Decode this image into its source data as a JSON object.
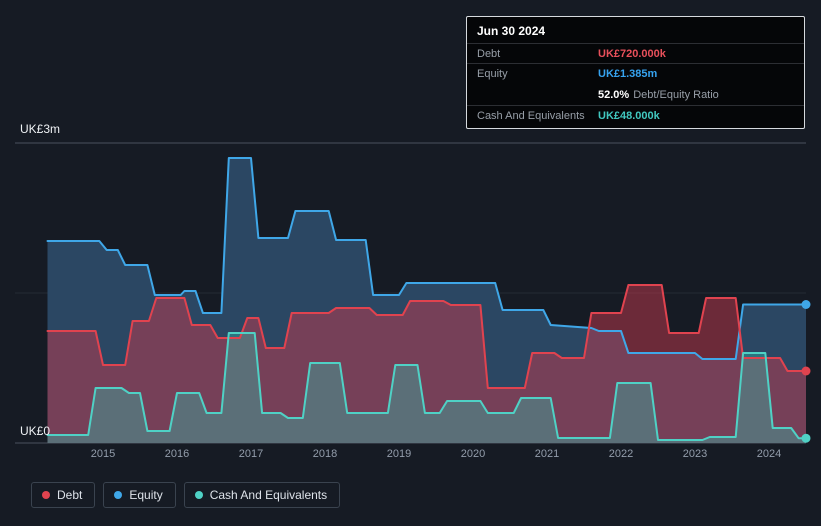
{
  "tooltip": {
    "date": "Jun 30 2024",
    "rows": {
      "debt_label": "Debt",
      "debt_value": "UK£720.000k",
      "equity_label": "Equity",
      "equity_value": "UK£1.385m",
      "ratio_value": "52.0%",
      "ratio_label": "Debt/Equity Ratio",
      "cash_label": "Cash And Equivalents",
      "cash_value": "UK£48.000k"
    }
  },
  "axis": {
    "y_top": "UK£3m",
    "y_bottom": "UK£0",
    "years": [
      "2015",
      "2016",
      "2017",
      "2018",
      "2019",
      "2020",
      "2021",
      "2022",
      "2023",
      "2024"
    ]
  },
  "legend": [
    {
      "label": "Debt",
      "color": "#e0434f"
    },
    {
      "label": "Equity",
      "color": "#3fa7e8"
    },
    {
      "label": "Cash And Equivalents",
      "color": "#4fd1c5"
    }
  ],
  "colors": {
    "debt": "#e8505b",
    "equity": "#36a3f0",
    "cash": "#41c8c0"
  },
  "chart_data": {
    "type": "area",
    "title": "",
    "y_unit": "UK£m",
    "ylim": [
      0,
      3
    ],
    "x_range": [
      2014.2,
      2024.55
    ],
    "x_ticks": [
      2015,
      2016,
      2017,
      2018,
      2019,
      2020,
      2021,
      2022,
      2023,
      2024
    ],
    "grid": "horizontal",
    "legend_position": "bottom-left",
    "last_point": {
      "date": "Jun 30 2024",
      "debt_m": 0.72,
      "equity_m": 1.385,
      "cash_m": 0.048,
      "debt_equity_ratio_pct": 52.0
    },
    "series": [
      {
        "name": "Equity",
        "color": "#3fa7e8",
        "fill": "#2b4763",
        "fill_opacity": 1,
        "points": [
          [
            2014.25,
            2.02
          ],
          [
            2014.95,
            2.02
          ],
          [
            2015.05,
            1.93
          ],
          [
            2015.2,
            1.93
          ],
          [
            2015.3,
            1.78
          ],
          [
            2015.6,
            1.78
          ],
          [
            2015.7,
            1.48
          ],
          [
            2016.05,
            1.48
          ],
          [
            2016.1,
            1.52
          ],
          [
            2016.25,
            1.52
          ],
          [
            2016.35,
            1.3
          ],
          [
            2016.6,
            1.3
          ],
          [
            2016.7,
            2.85
          ],
          [
            2017.0,
            2.85
          ],
          [
            2017.1,
            2.05
          ],
          [
            2017.5,
            2.05
          ],
          [
            2017.6,
            2.32
          ],
          [
            2018.05,
            2.32
          ],
          [
            2018.15,
            2.03
          ],
          [
            2018.55,
            2.03
          ],
          [
            2018.65,
            1.48
          ],
          [
            2019.0,
            1.48
          ],
          [
            2019.1,
            1.6
          ],
          [
            2020.3,
            1.6
          ],
          [
            2020.4,
            1.33
          ],
          [
            2020.95,
            1.33
          ],
          [
            2021.05,
            1.18
          ],
          [
            2021.6,
            1.15
          ],
          [
            2021.7,
            1.12
          ],
          [
            2022.0,
            1.12
          ],
          [
            2022.1,
            0.9
          ],
          [
            2023.0,
            0.9
          ],
          [
            2023.1,
            0.84
          ],
          [
            2023.55,
            0.84
          ],
          [
            2023.65,
            1.385
          ],
          [
            2024.5,
            1.385
          ]
        ]
      },
      {
        "name": "Debt",
        "color": "#e0434f",
        "fill": "#c23a4e",
        "fill_opacity": 0.5,
        "points": [
          [
            2014.25,
            1.12
          ],
          [
            2014.9,
            1.12
          ],
          [
            2015.0,
            0.78
          ],
          [
            2015.3,
            0.78
          ],
          [
            2015.4,
            1.22
          ],
          [
            2015.62,
            1.22
          ],
          [
            2015.72,
            1.45
          ],
          [
            2016.1,
            1.45
          ],
          [
            2016.2,
            1.18
          ],
          [
            2016.45,
            1.18
          ],
          [
            2016.55,
            1.05
          ],
          [
            2016.85,
            1.05
          ],
          [
            2016.95,
            1.25
          ],
          [
            2017.1,
            1.25
          ],
          [
            2017.2,
            0.95
          ],
          [
            2017.45,
            0.95
          ],
          [
            2017.55,
            1.3
          ],
          [
            2018.05,
            1.3
          ],
          [
            2018.15,
            1.35
          ],
          [
            2018.6,
            1.35
          ],
          [
            2018.7,
            1.28
          ],
          [
            2019.05,
            1.28
          ],
          [
            2019.15,
            1.42
          ],
          [
            2019.6,
            1.42
          ],
          [
            2019.7,
            1.38
          ],
          [
            2020.1,
            1.38
          ],
          [
            2020.2,
            0.55
          ],
          [
            2020.7,
            0.55
          ],
          [
            2020.8,
            0.9
          ],
          [
            2021.1,
            0.9
          ],
          [
            2021.2,
            0.85
          ],
          [
            2021.5,
            0.85
          ],
          [
            2021.6,
            1.3
          ],
          [
            2022.0,
            1.3
          ],
          [
            2022.1,
            1.58
          ],
          [
            2022.55,
            1.58
          ],
          [
            2022.65,
            1.1
          ],
          [
            2023.05,
            1.1
          ],
          [
            2023.15,
            1.45
          ],
          [
            2023.55,
            1.45
          ],
          [
            2023.65,
            0.85
          ],
          [
            2024.15,
            0.85
          ],
          [
            2024.25,
            0.72
          ],
          [
            2024.5,
            0.72
          ]
        ]
      },
      {
        "name": "Cash And Equivalents",
        "color": "#4fd1c5",
        "fill": "#2fbcae",
        "fill_opacity": 0.38,
        "points": [
          [
            2014.25,
            0.08
          ],
          [
            2014.8,
            0.08
          ],
          [
            2014.9,
            0.55
          ],
          [
            2015.25,
            0.55
          ],
          [
            2015.35,
            0.5
          ],
          [
            2015.5,
            0.5
          ],
          [
            2015.6,
            0.12
          ],
          [
            2015.9,
            0.12
          ],
          [
            2016.0,
            0.5
          ],
          [
            2016.3,
            0.5
          ],
          [
            2016.4,
            0.3
          ],
          [
            2016.6,
            0.3
          ],
          [
            2016.7,
            1.1
          ],
          [
            2017.05,
            1.1
          ],
          [
            2017.15,
            0.3
          ],
          [
            2017.4,
            0.3
          ],
          [
            2017.5,
            0.25
          ],
          [
            2017.7,
            0.25
          ],
          [
            2017.8,
            0.8
          ],
          [
            2018.2,
            0.8
          ],
          [
            2018.3,
            0.3
          ],
          [
            2018.85,
            0.3
          ],
          [
            2018.95,
            0.78
          ],
          [
            2019.25,
            0.78
          ],
          [
            2019.35,
            0.3
          ],
          [
            2019.55,
            0.3
          ],
          [
            2019.65,
            0.42
          ],
          [
            2020.1,
            0.42
          ],
          [
            2020.2,
            0.3
          ],
          [
            2020.55,
            0.3
          ],
          [
            2020.65,
            0.45
          ],
          [
            2021.05,
            0.45
          ],
          [
            2021.15,
            0.05
          ],
          [
            2021.85,
            0.05
          ],
          [
            2021.95,
            0.6
          ],
          [
            2022.4,
            0.6
          ],
          [
            2022.5,
            0.03
          ],
          [
            2023.1,
            0.03
          ],
          [
            2023.2,
            0.06
          ],
          [
            2023.55,
            0.06
          ],
          [
            2023.65,
            0.9
          ],
          [
            2023.95,
            0.9
          ],
          [
            2024.05,
            0.15
          ],
          [
            2024.3,
            0.15
          ],
          [
            2024.4,
            0.048
          ],
          [
            2024.5,
            0.048
          ]
        ]
      }
    ]
  }
}
